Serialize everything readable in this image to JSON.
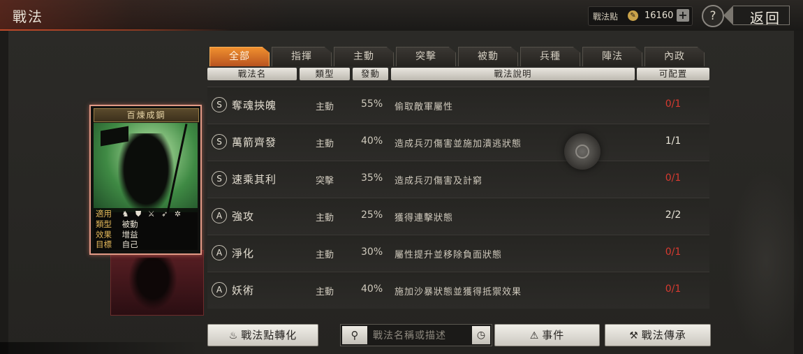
{
  "header": {
    "title": "戰法",
    "points_label": "戰法點",
    "points_value": "16160",
    "plus_label": "+",
    "help_label": "?",
    "back_label": "返回"
  },
  "tabs": [
    {
      "label": "全部",
      "active": true
    },
    {
      "label": "指揮",
      "active": false
    },
    {
      "label": "主動",
      "active": false
    },
    {
      "label": "突擊",
      "active": false
    },
    {
      "label": "被動",
      "active": false
    },
    {
      "label": "兵種",
      "active": false
    },
    {
      "label": "陣法",
      "active": false
    },
    {
      "label": "內政",
      "active": false
    }
  ],
  "columns": {
    "name": "戰法名",
    "type": "類型",
    "rate": "發動",
    "desc": "戰法說明",
    "avail": "可配置"
  },
  "rows": [
    {
      "grade": "S",
      "name": "奪魂挾魄",
      "type": "主動",
      "rate": "55%",
      "desc": "偷取敵軍屬性",
      "avail": "0/1",
      "avail_color": "#d73a30"
    },
    {
      "grade": "S",
      "name": "萬箭齊發",
      "type": "主動",
      "rate": "40%",
      "desc": "造成兵刃傷害並施加潰逃狀態",
      "avail": "1/1",
      "avail_color": "#eae5d9"
    },
    {
      "grade": "S",
      "name": "速乘其利",
      "type": "突擊",
      "rate": "35%",
      "desc": "造成兵刃傷害及計窮",
      "avail": "0/1",
      "avail_color": "#d73a30"
    },
    {
      "grade": "A",
      "name": "強攻",
      "type": "主動",
      "rate": "25%",
      "desc": "獲得連擊狀態",
      "avail": "2/2",
      "avail_color": "#eae5d9"
    },
    {
      "grade": "A",
      "name": "淨化",
      "type": "主動",
      "rate": "30%",
      "desc": "屬性提升並移除負面狀態",
      "avail": "0/1",
      "avail_color": "#d73a30"
    },
    {
      "grade": "A",
      "name": "妖術",
      "type": "主動",
      "rate": "40%",
      "desc": "施加沙暴狀態並獲得抵禦效果",
      "avail": "0/1",
      "avail_color": "#d73a30"
    }
  ],
  "card": {
    "title": "百煉成鋼",
    "applies_label": "適用",
    "type_label": "類型",
    "type_value": "被動",
    "effect_label": "效果",
    "effect_value": "增益",
    "target_label": "目標",
    "target_value": "自己",
    "unit_icons": "♞ ⛊ ⚔ ➶ ✲"
  },
  "bottom": {
    "convert_label": "戰法點轉化",
    "search_placeholder": "戰法名稱或描述",
    "event_label": "事件",
    "inherit_label": "戰法傳承"
  }
}
